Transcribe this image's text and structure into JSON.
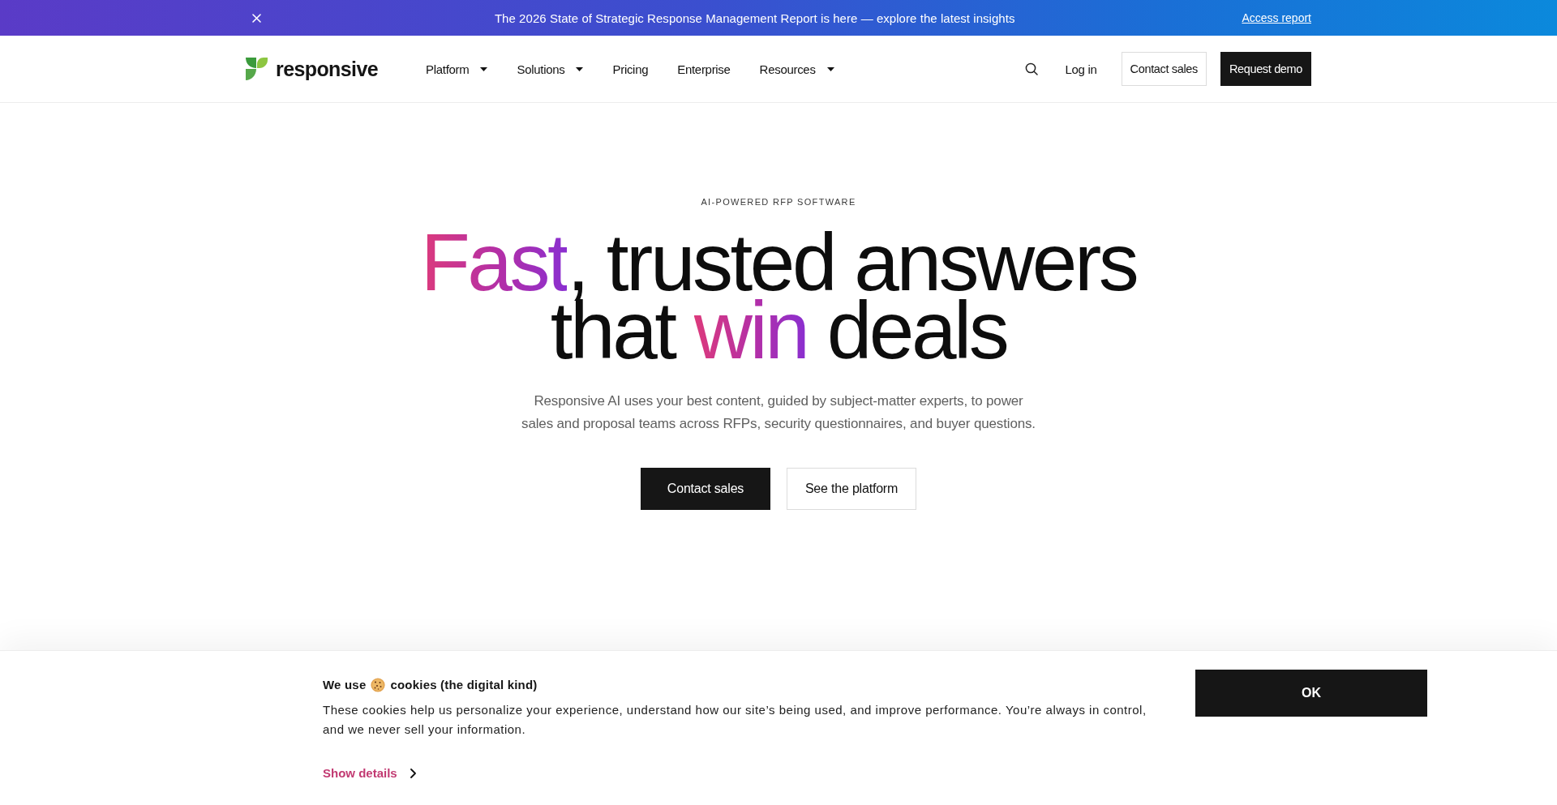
{
  "promo_bar": {
    "message": "The 2026 State of Strategic Response Management Report is here — explore the latest insights",
    "link": "Access report"
  },
  "header": {
    "logo": "responsive",
    "nav": [
      {
        "label": "Platform",
        "has_menu": true
      },
      {
        "label": "Solutions",
        "has_menu": true
      },
      {
        "label": "Pricing",
        "has_menu": false
      },
      {
        "label": "Enterprise",
        "has_menu": false
      },
      {
        "label": "Resources",
        "has_menu": true
      }
    ],
    "login": "Log in",
    "buttons": [
      {
        "label": "Contact sales",
        "kind": "outline"
      },
      {
        "label": "Request demo",
        "kind": "solid"
      }
    ]
  },
  "hero": {
    "eyebrow": "AI-POWERED RFP SOFTWARE",
    "headline": [
      [
        {
          "text": "Fast",
          "accent": true
        },
        {
          "text": ", trusted answers",
          "accent": false
        }
      ],
      [
        {
          "text": "that ",
          "accent": false
        },
        {
          "text": "win",
          "accent": true
        },
        {
          "text": " deals",
          "accent": false
        }
      ]
    ],
    "subtitle": "Responsive AI uses your best content, guided by subject-matter experts, to power sales and proposal teams across RFPs, security questionnaires, and buyer questions.",
    "buttons": [
      {
        "label": "Contact sales",
        "kind": "solid"
      },
      {
        "label": "See the platform",
        "kind": "outline"
      }
    ]
  },
  "cookie_banner": {
    "title_before": "We use",
    "title_after": "cookies (the digital kind)",
    "text": "These cookies help us personalize your experience, understand how our site’s being used, and improve performance. You’re always in control, and we never sell your information.",
    "details_link": "Show details",
    "button": "OK"
  }
}
